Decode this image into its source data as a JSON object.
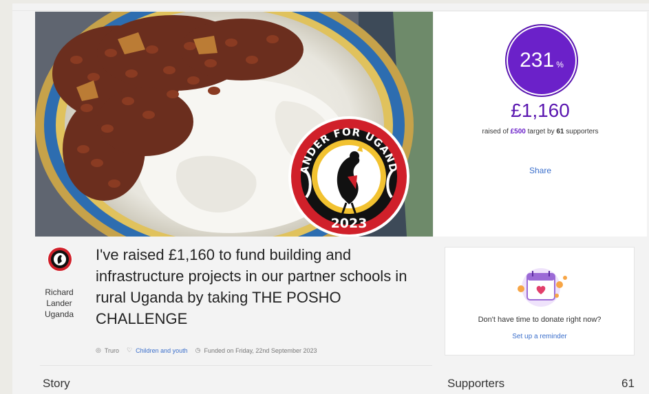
{
  "hero": {
    "badge_top_text": "LANDER FOR UGANDA",
    "badge_year": "2023"
  },
  "stats": {
    "percent_value": "231",
    "percent_sign": "%",
    "raised_amount": "£1,160",
    "raised_prefix": "raised of",
    "target_amount": "£500",
    "target_mid": "target by",
    "supporters_count": "61",
    "supporters_suffix": "supporters",
    "share_label": "Share"
  },
  "fundraiser": {
    "org_name": "Richard Lander Uganda",
    "org_name_line1": "Richard",
    "org_name_line2": "Lander",
    "org_name_line3": "Uganda",
    "headline": "I've raised £1,160 to fund building and infrastructure projects in our partner schools in rural Uganda by taking THE POSHO CHALLENGE",
    "location": "Truro",
    "category": "Children and youth",
    "funded_date": "Funded on Friday, 22nd September 2023"
  },
  "story_label": "Story",
  "reminder": {
    "text": "Don't have time to donate right now?",
    "link_label": "Set up a reminder"
  },
  "supporters": {
    "label": "Supporters",
    "count": "61"
  },
  "icons": {
    "location": "location-pin-icon",
    "category": "heart-icon",
    "funded": "clock-icon",
    "reminder": "calendar-heart-icon"
  },
  "colors": {
    "accent_purple": "#6b21c9",
    "link_blue": "#3a6ecb",
    "badge_red": "#d0202a"
  }
}
